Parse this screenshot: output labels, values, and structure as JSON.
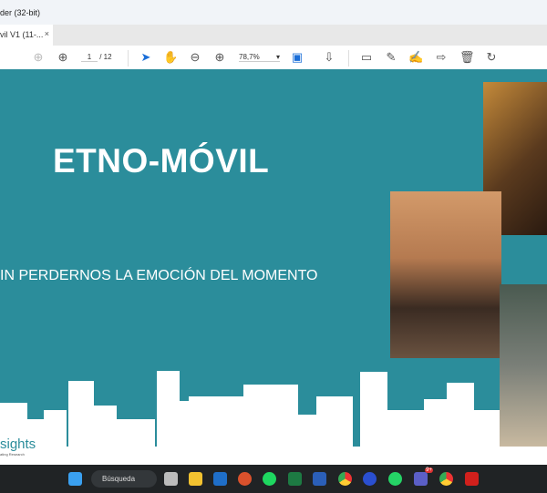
{
  "window": {
    "title": "der (32-bit)"
  },
  "tab": {
    "label": "vil V1 (11-...",
    "close": "×"
  },
  "toolbar": {
    "page_current": "1",
    "page_total": "/ 12",
    "zoom": "78,7%",
    "zoom_arrow": "▾"
  },
  "slide": {
    "title": "ETNO-MÓVIL",
    "subtitle": "IN PERDERNOS LA EMOCIÓN DEL MOMENTO",
    "logo_text": "sights",
    "logo_tagline": "ating Research",
    "bg_color": "#2b8d9b"
  },
  "taskbar": {
    "search_label": "Búsqueda",
    "search_icon": "🔍",
    "apps": [
      "file-view",
      "file-explorer",
      "outlook",
      "powerpoint",
      "spotify",
      "excel",
      "word",
      "chrome",
      "webex",
      "whatsapp",
      "teams",
      "chrome-profile",
      "acrobat"
    ],
    "teams_badge": "9+"
  }
}
